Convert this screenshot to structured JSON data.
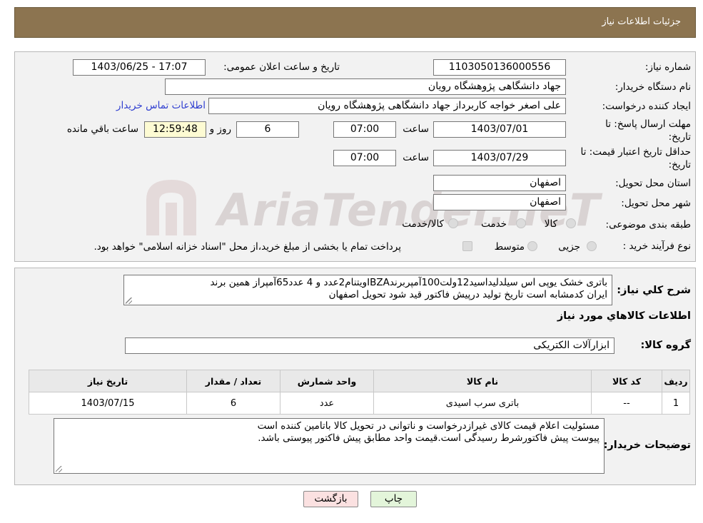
{
  "header": {
    "title": "جزئیات اطلاعات نیاز"
  },
  "watermark": {
    "text": "AriaTender.neT"
  },
  "form": {
    "need_number_label": "شماره نیاز:",
    "need_number": "1103050136000556",
    "announce_label": "تاریخ و ساعت اعلان عمومی:",
    "announce_value": "1403/06/25 - 17:07",
    "buyer_org_label": "نام دستگاه خریدار:",
    "buyer_org": "جهاد دانشگاهی پژوهشگاه رویان",
    "creator_label": "ایجاد کننده درخواست:",
    "creator": "علی اصغر خواجه کاربرداز جهاد دانشگاهی پژوهشگاه رویان",
    "contact_link": "اطلاعات تماس خریدار",
    "deadline_label_1": "مهلت ارسال پاسخ: تا",
    "deadline_label_2": "تاریخ:",
    "deadline_date": "1403/07/01",
    "time_label": "ساعت",
    "deadline_time": "07:00",
    "days_value": "6",
    "days_label": "روز و",
    "remaining_time": "12:59:48",
    "remaining_label": "ساعت باقي مانده",
    "validity_label_1": "حداقل تاریخ اعتبار قیمت: تا",
    "validity_label_2": "تاریخ:",
    "validity_date": "1403/07/29",
    "validity_time": "07:00",
    "province_label": "استان محل تحویل:",
    "province": "اصفهان",
    "city_label": "شهر محل تحویل:",
    "city": "اصفهان",
    "category_label": "طبقه بندی موضوعی:",
    "category_options": [
      "کالا",
      "خدمت",
      "کالا/خدمت"
    ],
    "process_label": "نوع فرآیند خرید :",
    "process_options": [
      "جزیی",
      "متوسط"
    ],
    "process_note": "پرداخت تمام یا بخشی از مبلغ خرید،از محل \"اسناد خزانه اسلامی\" خواهد بود."
  },
  "description": {
    "label": "شرح کلي نياز:",
    "line1": "باتری خشک یوپی اس سیلدلیداسید12ولت100آمپربرندIBZAویتنام2عدد و 4 عدد65آمپراز همین برند",
    "line2": "ایران کدمشابه است تاریخ تولید درپیش فاکتور قید شود تحویل اصفهان"
  },
  "goods": {
    "section_title": "اطلاعات کالاهاي مورد نياز",
    "group_label": "گروه کالا:",
    "group_value": "ابزارآلات الکتریکی",
    "columns": [
      "رديف",
      "کد کالا",
      "نام کالا",
      "واحد شمارش",
      "تعداد / مقدار",
      "تاریخ نیاز"
    ],
    "rows": [
      {
        "row": "1",
        "code": "--",
        "name": "باتری سرب اسیدی",
        "unit": "عدد",
        "qty": "6",
        "date": "1403/07/15"
      }
    ]
  },
  "buyer_notes": {
    "label": "توضیحات خریدار:",
    "line1": "مسئولیت اعلام قیمت کالای غیرازدرخواست و ناتوانی در تحویل کالا باتامین کننده است",
    "line2": "پیوست پیش فاکتورشرط رسیدگی است.قیمت واحد مطابق پیش فاکتور پیوستی باشد."
  },
  "buttons": {
    "print": "چاپ",
    "back": "بازگشت"
  },
  "colors": {
    "header_bg": "#8c7450",
    "back_button_bg": "#fbe1e1",
    "print_button_bg": "#e3f5da",
    "link": "#2f3ed0"
  }
}
